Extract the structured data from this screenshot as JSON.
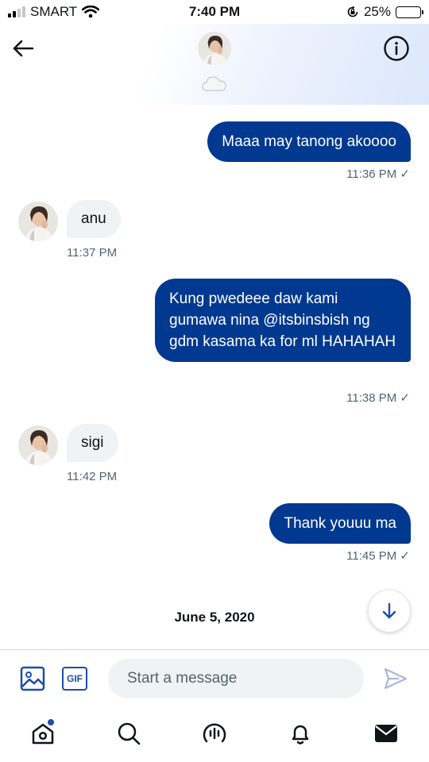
{
  "status": {
    "carrier": "SMART",
    "time": "7:40 PM",
    "battery": "25%"
  },
  "header": {
    "back_icon": "arrow-left-icon",
    "info_icon": "info-icon",
    "status_icon": "cloud-icon"
  },
  "messages": [
    {
      "direction": "out",
      "text": "Maaa may tanong akoooo",
      "time": "11:36 PM ✓"
    },
    {
      "direction": "in",
      "text": "anu",
      "time": "11:37 PM"
    },
    {
      "direction": "out",
      "text": "Kung pwedeee daw kami gumawa nina @itsbinsbish ng gdm kasama ka for ml HAHAHAH",
      "time": "11:38 PM ✓"
    },
    {
      "direction": "in",
      "text": "sigi",
      "time": "11:42 PM"
    },
    {
      "direction": "out",
      "text": "Thank youuu ma",
      "time": "11:45 PM ✓"
    }
  ],
  "date_separator": "June 5, 2020",
  "composer": {
    "placeholder": "Start a message",
    "gif_label": "GIF"
  },
  "colors": {
    "accent": "#00398f",
    "incoming_bubble": "#eff3f4",
    "icon_blue": "#1d4ea8"
  },
  "tabs": [
    "home-icon",
    "search-icon",
    "spaces-icon",
    "notifications-icon",
    "messages-icon"
  ]
}
